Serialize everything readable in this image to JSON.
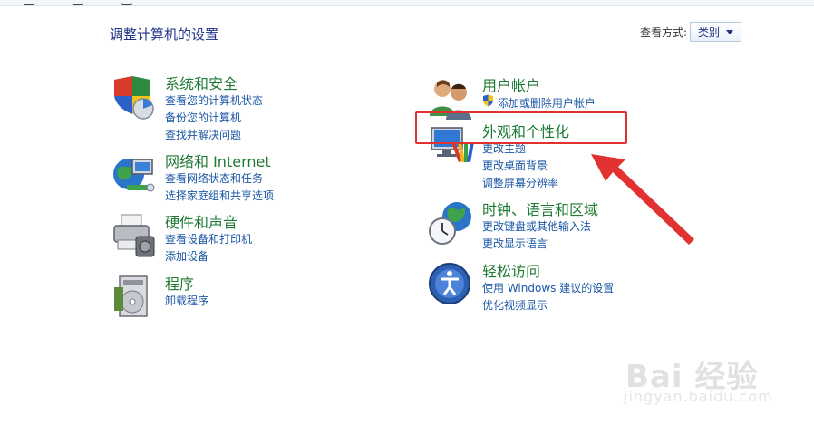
{
  "page_title": "调整计算机的设置",
  "view_by": {
    "label": "查看方式:",
    "value": "类别"
  },
  "categories": [
    {
      "title": "系统和安全",
      "links": [
        "查看您的计算机状态",
        "备份您的计算机",
        "查找并解决问题"
      ]
    },
    {
      "title": "网络和 Internet",
      "links": [
        "查看网络状态和任务",
        "选择家庭组和共享选项"
      ]
    },
    {
      "title": "硬件和声音",
      "links": [
        "查看设备和打印机",
        "添加设备"
      ]
    },
    {
      "title": "程序",
      "links": [
        "卸载程序"
      ]
    },
    {
      "title": "用户帐户",
      "links": [
        "添加或删除用户帐户"
      ]
    },
    {
      "title": "外观和个性化",
      "links": [
        "更改主题",
        "更改桌面背景",
        "调整屏幕分辨率"
      ]
    },
    {
      "title": "时钟、语言和区域",
      "links": [
        "更改键盘或其他输入法",
        "更改显示语言"
      ]
    },
    {
      "title": "轻松访问",
      "links": [
        "使用 Windows 建议的设置",
        "优化视频显示"
      ]
    }
  ],
  "watermark": {
    "main": "Bai 经验",
    "sub": "jingyan.baidu.com"
  },
  "colors": {
    "title": "#1e3287",
    "category": "#1e7a33",
    "link": "#1b57a6",
    "annotation": "#e23131"
  }
}
